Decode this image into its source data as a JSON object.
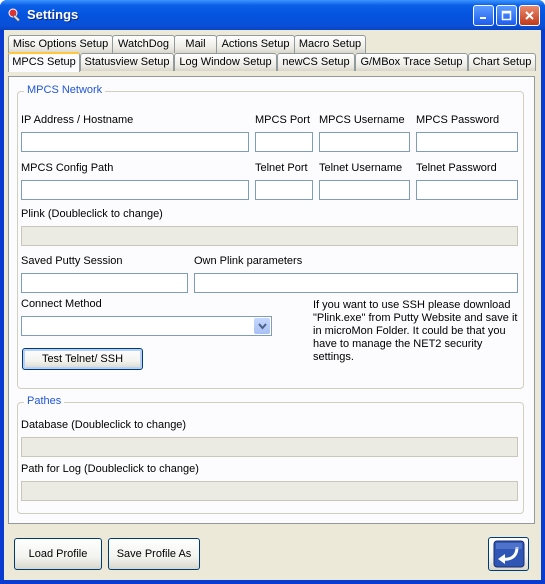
{
  "window": {
    "title": "Settings"
  },
  "tabs_row1": [
    "Misc Options Setup",
    "WatchDog",
    "Mail",
    "Actions Setup",
    "Macro Setup"
  ],
  "tabs_row2": [
    "MPCS Setup",
    "Statusview Setup",
    "Log Window Setup",
    "newCS Setup",
    "G/MBox Trace Setup",
    "Chart Setup"
  ],
  "mpcs_network": {
    "legend": "MPCS Network",
    "ip_label": "IP Address / Hostname",
    "port_label": "MPCS Port",
    "username_label": "MPCS Username",
    "password_label": "MPCS Password",
    "config_path_label": "MPCS Config Path",
    "telnet_port_label": "Telnet Port",
    "telnet_username_label": "Telnet Username",
    "telnet_password_label": "Telnet Password",
    "plink_label": "Plink  (Doubleclick to change)",
    "saved_session_label": "Saved Putty Session",
    "plink_params_label": "Own Plink parameters",
    "connect_method_label": "Connect Method",
    "connect_method_value": "",
    "test_button": "Test Telnet/ SSH",
    "info_text": "If you want to use SSH please download \"Plink.exe\" from Putty Website and save it in microMon Folder. It could be that you have to manage the NET2 security settings."
  },
  "pathes": {
    "legend": "Pathes",
    "database_label": "Database  (Doubleclick to change)",
    "log_label": "Path for Log (Doubleclick to change)"
  },
  "footer": {
    "load_profile": "Load Profile",
    "save_profile_as": "Save Profile As"
  },
  "colors": {
    "title_bar": "#0554e0",
    "legend_text": "#2156d6",
    "active_tab_accent": "#ffc83c"
  }
}
